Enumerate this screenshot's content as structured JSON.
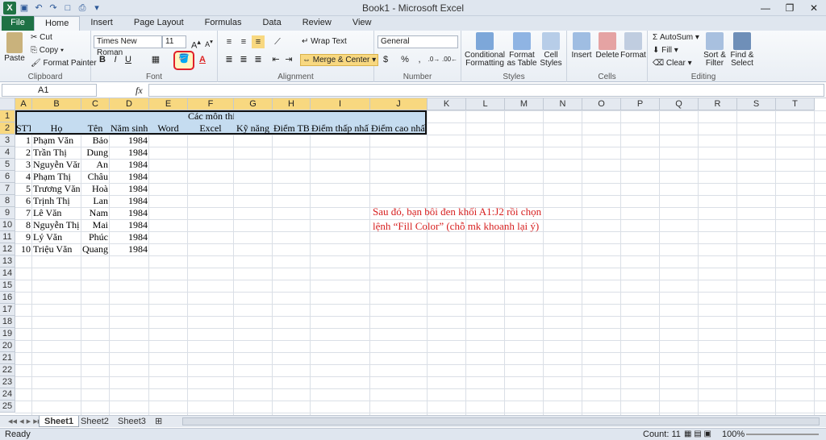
{
  "app": {
    "title": "Book1 - Microsoft Excel"
  },
  "tabs": [
    "File",
    "Home",
    "Insert",
    "Page Layout",
    "Formulas",
    "Data",
    "Review",
    "View"
  ],
  "ribbon": {
    "clipboard": {
      "label": "Clipboard",
      "paste": "Paste",
      "cut": "Cut",
      "copy": "Copy",
      "format_painter": "Format Painter"
    },
    "font": {
      "label": "Font",
      "name": "Times New Roman",
      "size": "11",
      "bold": "B",
      "italic": "I",
      "underline": "U",
      "font_color": "A"
    },
    "alignment": {
      "label": "Alignment",
      "wrap": "Wrap Text",
      "merge": "Merge & Center"
    },
    "number": {
      "label": "Number",
      "format": "General",
      "currency": "$",
      "percent": "%",
      "comma": ","
    },
    "styles": {
      "label": "Styles",
      "cond": "Conditional Formatting",
      "table": "Format as Table",
      "cell": "Cell Styles"
    },
    "cells": {
      "label": "Cells",
      "insert": "Insert",
      "delete": "Delete",
      "format": "Format"
    },
    "editing": {
      "label": "Editing",
      "autosum": "AutoSum",
      "fill": "Fill",
      "clear": "Clear",
      "sort": "Sort & Filter",
      "find": "Find & Select"
    }
  },
  "formula_bar": {
    "name_box": "A1",
    "fx": "fx",
    "value": ""
  },
  "columns": [
    "A",
    "B",
    "C",
    "D",
    "E",
    "F",
    "G",
    "H",
    "I",
    "J",
    "K",
    "L",
    "M",
    "N",
    "O",
    "P",
    "Q",
    "R",
    "S",
    "T"
  ],
  "rows": [
    "1",
    "2",
    "3",
    "4",
    "5",
    "6",
    "7",
    "8",
    "9",
    "10",
    "11",
    "12",
    "13",
    "14",
    "15",
    "16",
    "17",
    "18",
    "19",
    "20",
    "21",
    "22",
    "23",
    "24",
    "25"
  ],
  "header_row1": {
    "merged": "Các môn thi"
  },
  "header_row2": [
    "STT",
    "Họ",
    "Tên",
    "Năm sinh",
    "Word",
    "Excel",
    "Kỹ năng",
    "Điểm TB",
    "Điểm thấp nhất",
    "Điểm cao nhất"
  ],
  "data_rows": [
    [
      "1",
      "Phạm Văn",
      "Bảo",
      "1984"
    ],
    [
      "2",
      "Trần Thị",
      "Dung",
      "1984"
    ],
    [
      "3",
      "Nguyễn Văn",
      "An",
      "1984"
    ],
    [
      "4",
      "Phạm Thị",
      "Châu",
      "1984"
    ],
    [
      "5",
      "Trương Văn",
      "Hoà",
      "1984"
    ],
    [
      "6",
      "Trịnh Thị",
      "Lan",
      "1984"
    ],
    [
      "7",
      "Lê Văn",
      "Nam",
      "1984"
    ],
    [
      "8",
      "Nguyễn Thị",
      "Mai",
      "1984"
    ],
    [
      "9",
      "Lý Văn",
      "Phúc",
      "1984"
    ],
    [
      "10",
      "Triệu Văn",
      "Quang",
      "1984"
    ]
  ],
  "annotation": {
    "line1": "Sau đó, bạn bôi đen khối A1:J2 rồi chọn",
    "line2": "lệnh “Fill Color” (chỗ mk khoanh lại ý)"
  },
  "sheets": [
    "Sheet1",
    "Sheet2",
    "Sheet3"
  ],
  "status": {
    "ready": "Ready",
    "count": "Count: 11",
    "zoom": "100%"
  },
  "colors": {
    "selection": "#c5dcf0",
    "header_highlight": "#f8d880",
    "annotation": "#d72020",
    "fill_color_outline": "#e0202a"
  }
}
